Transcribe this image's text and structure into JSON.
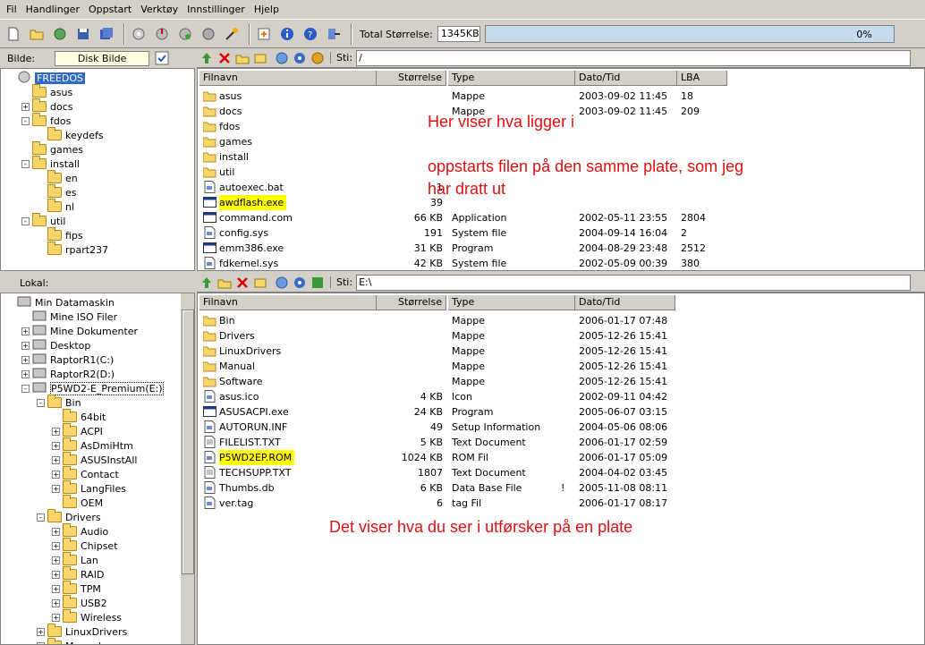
{
  "menu": [
    "Fil",
    "Handlinger",
    "Oppstart",
    "Verktøy",
    "Innstillinger",
    "Hjelp"
  ],
  "toolbar": {
    "total_label": "Total Størrelse:",
    "total_value": "1345KB",
    "progress_text": "0%",
    "progress_value": 0
  },
  "top": {
    "image_label": "Bilde:",
    "disk_button": "Disk Bilde",
    "path_label": "Sti:",
    "path_value": "/",
    "tree": [
      {
        "label": "FREEDOS",
        "level": 0,
        "selected": true
      },
      {
        "label": "asus",
        "level": 1
      },
      {
        "label": "docs",
        "level": 1,
        "expander": "+"
      },
      {
        "label": "fdos",
        "level": 1,
        "expander": "-"
      },
      {
        "label": "keydefs",
        "level": 2
      },
      {
        "label": "games",
        "level": 1
      },
      {
        "label": "install",
        "level": 1,
        "expander": "-"
      },
      {
        "label": "en",
        "level": 2
      },
      {
        "label": "es",
        "level": 2
      },
      {
        "label": "nl",
        "level": 2
      },
      {
        "label": "util",
        "level": 1,
        "expander": "-"
      },
      {
        "label": "fips",
        "level": 2
      },
      {
        "label": "rpart237",
        "level": 2
      }
    ],
    "columns": [
      "Filnavn",
      "Størrelse",
      "Type",
      "Dato/Tid",
      "LBA"
    ],
    "files": [
      {
        "name": "asus",
        "size": "",
        "type": "Mappe",
        "date": "2003-09-02 11:45",
        "lba": "18",
        "kind": "folder"
      },
      {
        "name": "docs",
        "size": "",
        "type": "Mappe",
        "date": "2003-09-02 11:45",
        "lba": "209",
        "kind": "folder"
      },
      {
        "name": "fdos",
        "size": "",
        "type": "",
        "date": "",
        "lba": "",
        "kind": "folder"
      },
      {
        "name": "games",
        "size": "",
        "type": "",
        "date": "",
        "lba": "",
        "kind": "folder"
      },
      {
        "name": "install",
        "size": "",
        "type": "",
        "date": "",
        "lba": "",
        "kind": "folder"
      },
      {
        "name": "util",
        "size": "",
        "type": "",
        "date": "",
        "lba": "",
        "kind": "folder"
      },
      {
        "name": "autoexec.bat",
        "size": "1",
        "type": "",
        "date": "",
        "lba": "",
        "kind": "file"
      },
      {
        "name": "awdflash.exe",
        "size": "39",
        "type": "",
        "date": "",
        "lba": "",
        "kind": "exe",
        "highlight": true
      },
      {
        "name": "command.com",
        "size": "66 KB",
        "type": "Application",
        "date": "2002-05-11 23:55",
        "lba": "2804",
        "kind": "exe"
      },
      {
        "name": "config.sys",
        "size": "191",
        "type": "System file",
        "date": "2004-09-14 16:04",
        "lba": "2",
        "kind": "file"
      },
      {
        "name": "emm386.exe",
        "size": "31 KB",
        "type": "Program",
        "date": "2004-08-29 23:48",
        "lba": "2512",
        "kind": "exe"
      },
      {
        "name": "fdkernel.sys",
        "size": "42 KB",
        "type": "System file",
        "date": "2002-05-09 00:39",
        "lba": "380",
        "kind": "file"
      }
    ]
  },
  "bottom": {
    "local_label": "Lokal:",
    "path_label": "Sti:",
    "path_value": "E:\\",
    "tree": [
      {
        "label": "Min Datamaskin",
        "level": 0,
        "icon": "computer"
      },
      {
        "label": "Mine ISO Filer",
        "level": 1,
        "icon": "disc"
      },
      {
        "label": "Mine Dokumenter",
        "level": 1,
        "expander": "+",
        "icon": "docs"
      },
      {
        "label": "Desktop",
        "level": 1,
        "expander": "+",
        "icon": "desktop"
      },
      {
        "label": "RaptorR1(C:)",
        "level": 1,
        "expander": "+",
        "icon": "drive"
      },
      {
        "label": "RaptorR2(D:)",
        "level": 1,
        "expander": "+",
        "icon": "drive"
      },
      {
        "label": "P5WD2-E_Premium(E:)",
        "level": 1,
        "expander": "-",
        "icon": "cdrom",
        "selected": true
      },
      {
        "label": "Bin",
        "level": 2,
        "expander": "-"
      },
      {
        "label": "64bit",
        "level": 3
      },
      {
        "label": "ACPI",
        "level": 3,
        "expander": "+"
      },
      {
        "label": "AsDmiHtm",
        "level": 3,
        "expander": "+"
      },
      {
        "label": "ASUSInstAll",
        "level": 3,
        "expander": "+"
      },
      {
        "label": "Contact",
        "level": 3,
        "expander": "+"
      },
      {
        "label": "LangFiles",
        "level": 3,
        "expander": "+"
      },
      {
        "label": "OEM",
        "level": 3
      },
      {
        "label": "Drivers",
        "level": 2,
        "expander": "-"
      },
      {
        "label": "Audio",
        "level": 3,
        "expander": "+"
      },
      {
        "label": "Chipset",
        "level": 3,
        "expander": "+"
      },
      {
        "label": "Lan",
        "level": 3,
        "expander": "+"
      },
      {
        "label": "RAID",
        "level": 3,
        "expander": "+"
      },
      {
        "label": "TPM",
        "level": 3,
        "expander": "+"
      },
      {
        "label": "USB2",
        "level": 3,
        "expander": "+"
      },
      {
        "label": "Wireless",
        "level": 3,
        "expander": "+"
      },
      {
        "label": "LinuxDrivers",
        "level": 2,
        "expander": "+"
      },
      {
        "label": "Manual",
        "level": 2,
        "expander": "+"
      }
    ],
    "columns": [
      "Filnavn",
      "Størrelse",
      "Type",
      "Dato/Tid"
    ],
    "files": [
      {
        "name": "Bin",
        "size": "",
        "type": "Mappe",
        "date": "2006-01-17 07:48",
        "kind": "folder"
      },
      {
        "name": "Drivers",
        "size": "",
        "type": "Mappe",
        "date": "2005-12-26 15:41",
        "kind": "folder"
      },
      {
        "name": "LinuxDrivers",
        "size": "",
        "type": "Mappe",
        "date": "2005-12-26 15:41",
        "kind": "folder"
      },
      {
        "name": "Manual",
        "size": "",
        "type": "Mappe",
        "date": "2005-12-26 15:41",
        "kind": "folder"
      },
      {
        "name": "Software",
        "size": "",
        "type": "Mappe",
        "date": "2005-12-26 15:41",
        "kind": "folder"
      },
      {
        "name": "asus.ico",
        "size": "4 KB",
        "type": "Icon",
        "date": "2002-09-11 04:42",
        "kind": "file"
      },
      {
        "name": "ASUSACPI.exe",
        "size": "24 KB",
        "type": "Program",
        "date": "2005-06-07 03:15",
        "kind": "exe"
      },
      {
        "name": "AUTORUN.INF",
        "size": "49",
        "type": "Setup Information",
        "date": "2004-05-06 08:06",
        "kind": "file"
      },
      {
        "name": "FILELIST.TXT",
        "size": "5 KB",
        "type": "Text Document",
        "date": "2006-01-17 02:59",
        "kind": "text"
      },
      {
        "name": "P5WD2EP.ROM",
        "size": "1024 KB",
        "type": "ROM Fil",
        "date": "2006-01-17 05:09",
        "kind": "file",
        "highlight": true
      },
      {
        "name": "TECHSUPP.TXT",
        "size": "1807",
        "type": "Text Document",
        "date": "2004-04-02 03:45",
        "kind": "text"
      },
      {
        "name": "Thumbs.db",
        "size": "6 KB",
        "type": "Data Base File",
        "date": "2005-11-08 08:11",
        "kind": "file",
        "flag": "!"
      },
      {
        "name": "ver.tag",
        "size": "6",
        "type": "tag Fil",
        "date": "2006-01-17 08:17",
        "kind": "file"
      }
    ]
  },
  "annotations": {
    "top_line1": "Her viser hva ligger i",
    "top_line2": "oppstarts filen på den samme plate, som jeg",
    "top_line3": "har dratt ut",
    "bottom": "Det viser hva du ser i utførsker på en plate"
  },
  "colors": {
    "annotation": "#e01010",
    "highlight": "#ffff00",
    "selection": "#316ac5",
    "progress": "#c6dbee"
  }
}
